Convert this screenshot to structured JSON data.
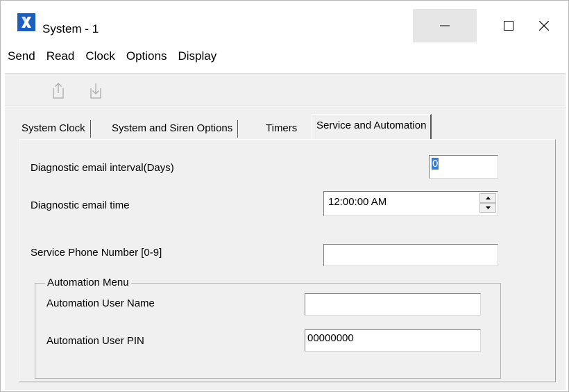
{
  "window": {
    "title": "System - 1",
    "icon": "app-x-icon",
    "controls": {
      "minimize_icon": "minimize-icon",
      "maximize_icon": "maximize-icon",
      "close_icon": "close-icon"
    }
  },
  "menu": {
    "items": [
      {
        "label": "Send"
      },
      {
        "label": "Read"
      },
      {
        "label": "Clock"
      },
      {
        "label": "Options"
      },
      {
        "label": "Display"
      }
    ]
  },
  "toolbar": {
    "buttons": [
      {
        "name": "send-button",
        "icon": "upload-icon"
      },
      {
        "name": "read-button",
        "icon": "download-icon"
      }
    ]
  },
  "tabs": {
    "items": [
      {
        "label": "System Clock"
      },
      {
        "label": "System and Siren Options"
      },
      {
        "label": "Timers"
      },
      {
        "label": "Service and Automation"
      }
    ],
    "active": "Service and Automation"
  },
  "service": {
    "email_interval_label": "Diagnostic email interval(Days)",
    "email_interval_value": "0",
    "email_time_label": "Diagnostic email time",
    "email_time_value": "12:00:00 AM",
    "phone_label": "Service Phone Number [0-9]",
    "phone_value": ""
  },
  "automation": {
    "group_title": "Automation Menu",
    "user_name_label": "Automation User Name",
    "user_name_value": "",
    "user_pin_label": "Automation User PIN",
    "user_pin_value": "00000000"
  },
  "colors": {
    "accent": "#1d5fbf",
    "selection": "#3b7bd8",
    "panel": "#f0f0f0"
  }
}
